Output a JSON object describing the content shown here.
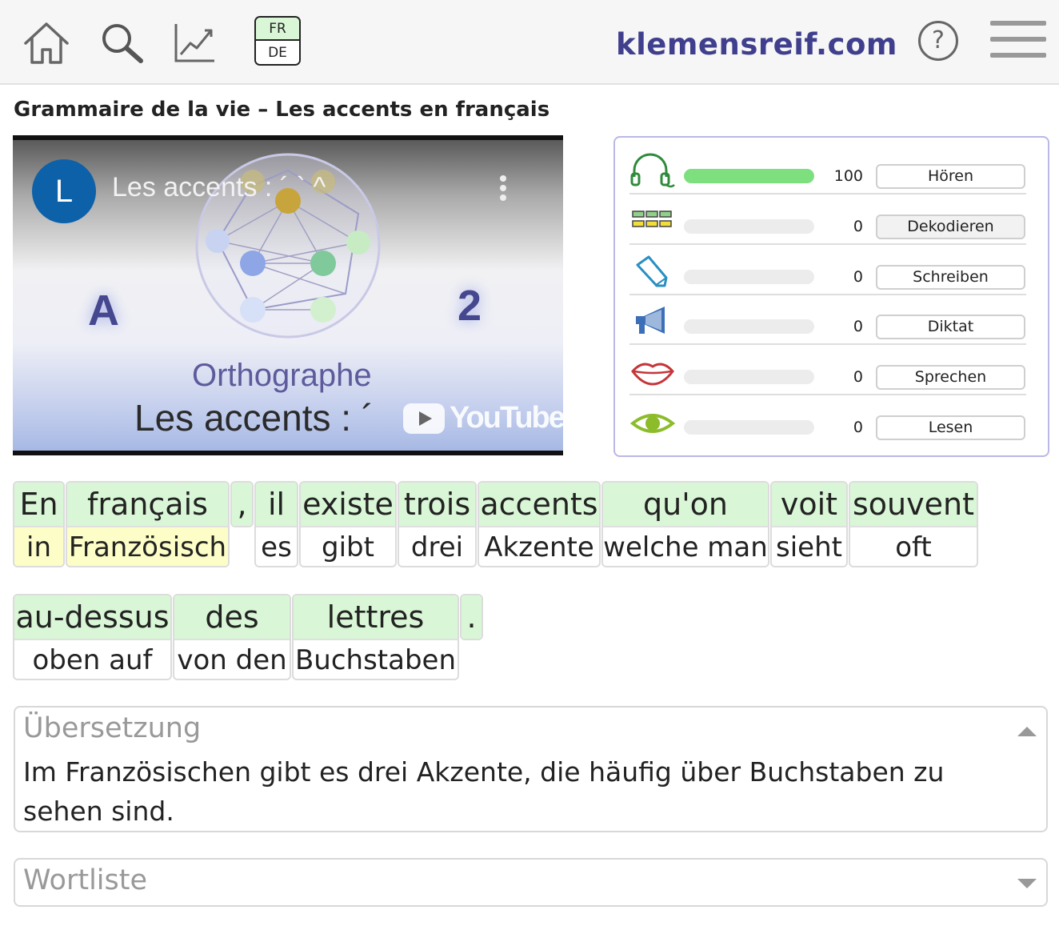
{
  "header": {
    "lang_top": "FR",
    "lang_bottom": "DE",
    "site": "klemensreif.com",
    "help": "?",
    "icons": [
      "home-icon",
      "search-icon",
      "chart-icon",
      "help-icon",
      "menu-icon"
    ]
  },
  "page_title": "Grammaire de la vie – Les accents en français",
  "video": {
    "channel_letter": "L",
    "title": "Les accents : ´ ` ^",
    "left_mark": "A",
    "right_mark": "2",
    "heading": "Orthographe",
    "subtitle": "Les accents : ´",
    "platform": "YouTube"
  },
  "skills": [
    {
      "name": "Hören",
      "value": "100",
      "progress": 1.0,
      "icon": "headphones-icon"
    },
    {
      "name": "Dekodieren",
      "value": "0",
      "progress": 0,
      "icon": "blocks-icon"
    },
    {
      "name": "Schreiben",
      "value": "0",
      "progress": 0,
      "icon": "pen-icon"
    },
    {
      "name": "Diktat",
      "value": "0",
      "progress": 0,
      "icon": "megaphone-icon"
    },
    {
      "name": "Sprechen",
      "value": "0",
      "progress": 0,
      "icon": "lips-icon"
    },
    {
      "name": "Lesen",
      "value": "0",
      "progress": 0,
      "icon": "eye-icon"
    }
  ],
  "sentence1": [
    {
      "fr": "En",
      "de": "in"
    },
    {
      "fr": "français",
      "de": "Französisch"
    },
    {
      "fr": ",",
      "de": ""
    },
    {
      "fr": "il",
      "de": "es"
    },
    {
      "fr": "existe",
      "de": "gibt"
    },
    {
      "fr": "trois",
      "de": "drei"
    },
    {
      "fr": "accents",
      "de": "Akzente"
    },
    {
      "fr": "qu'on",
      "de": "welche man"
    },
    {
      "fr": "voit",
      "de": "sieht"
    },
    {
      "fr": "souvent",
      "de": "oft"
    }
  ],
  "sentence2": [
    {
      "fr": "au-dessus",
      "de": "oben auf"
    },
    {
      "fr": "des",
      "de": "von den"
    },
    {
      "fr": "lettres",
      "de": "Buchstaben"
    },
    {
      "fr": ".",
      "de": ""
    }
  ],
  "translation": {
    "label": "Übersetzung",
    "text": "Im Französischen gibt es drei Akzente, die häufig über Buchstaben zu sehen sind."
  },
  "wordlist": {
    "label": "Wortliste"
  },
  "colors": {
    "brand": "#3f3f8e",
    "chip_green": "#d9f7d6",
    "highlight_yellow": "#fdfdc8",
    "progress_green": "#7ddf7e"
  }
}
